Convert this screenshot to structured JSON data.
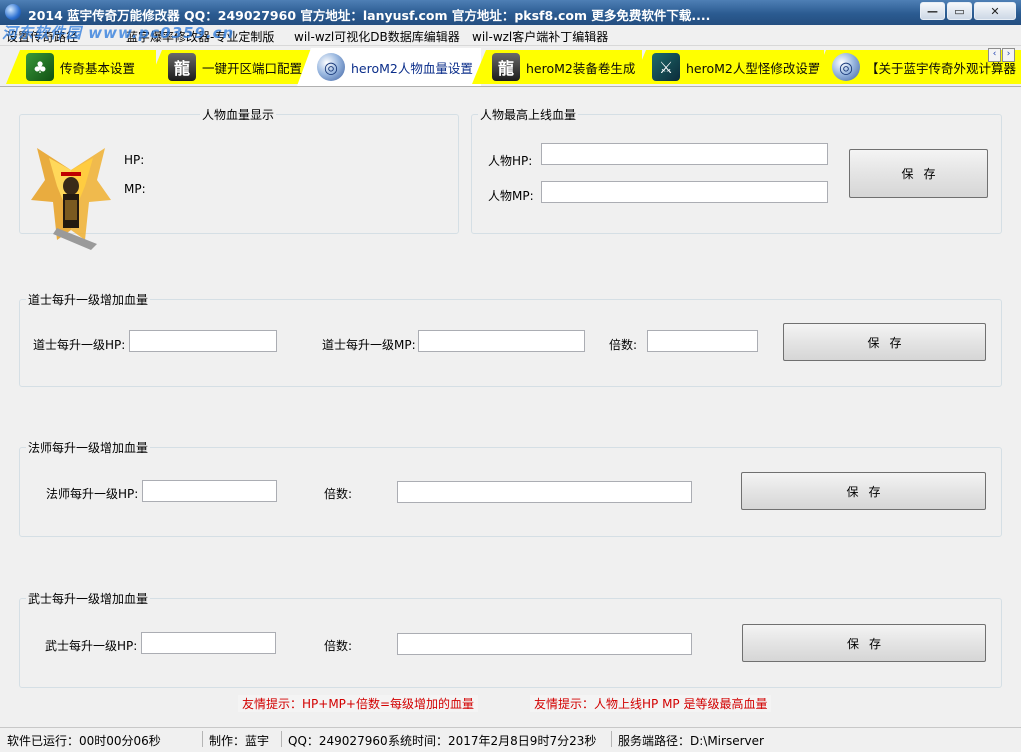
{
  "window": {
    "title": "2014 蓝宇传奇万能修改器 QQ：249027960 官方地址：lanyusf.com 官方地址：pksf8.com 更多免费软件下载....",
    "watermark": "河东软件园 www.pc0359.cn"
  },
  "menu": {
    "items": [
      "设置传奇路径",
      "蓝字爆率修改器-专业定制版",
      "wil-wzl可视化DB数据库编辑器",
      "wil-wzl客户端补丁编辑器"
    ]
  },
  "tabs": [
    {
      "label": "传奇基本设置",
      "icon": "tree-icon"
    },
    {
      "label": "一键开区端口配置",
      "icon": "dragon-icon"
    },
    {
      "label": "heroM2人物血量设置",
      "icon": "orb-icon",
      "active": true
    },
    {
      "label": "heroM2装备卷生成",
      "icon": "dragon-icon"
    },
    {
      "label": "heroM2人型怪修改设置",
      "icon": "sword-icon"
    },
    {
      "label": "【关于蓝宇传奇外观计算器",
      "icon": "orb-icon"
    }
  ],
  "display": {
    "title": "人物血量显示",
    "hp_label": "HP:",
    "mp_label": "MP:"
  },
  "max_online": {
    "title": "人物最高上线血量",
    "hp_label": "人物HP:",
    "mp_label": "人物MP:",
    "hp_value": "",
    "mp_value": "",
    "save_label": "保存"
  },
  "taoist": {
    "title": "道士每升一级增加血量",
    "hp_label": "道士每升一级HP:",
    "mp_label": "道士每升一级MP:",
    "mult_label": "倍数:",
    "hp_value": "",
    "mp_value": "",
    "mult_value": "",
    "save_label": "保存"
  },
  "mage": {
    "title": "法师每升一级增加血量",
    "hp_label": "法师每升一级HP:",
    "mult_label": "倍数:",
    "hp_value": "",
    "mult_value": "",
    "save_label": "保存"
  },
  "warrior": {
    "title": "武士每升一级增加血量",
    "hp_label": "武士每升一级HP:",
    "mult_label": "倍数:",
    "hp_value": "",
    "mult_value": "",
    "save_label": "保存"
  },
  "tips": {
    "tip1": "友情提示：HP+MP+倍数=每级增加的血量",
    "tip2": "友情提示：人物上线HP MP 是等级最高血量"
  },
  "status": {
    "runtime": "软件已运行：00时00分06秒",
    "author": "制作：蓝宇",
    "qq": "QQ：249027960",
    "system_time": "系统时间：2017年2月8日9时7分23秒",
    "server_path": "服务端路径：D:\\Mirserver"
  },
  "colors": {
    "tab_yellow": "#ffff00",
    "tip_red": "#d20000",
    "title_blue": "#2b5b91"
  }
}
